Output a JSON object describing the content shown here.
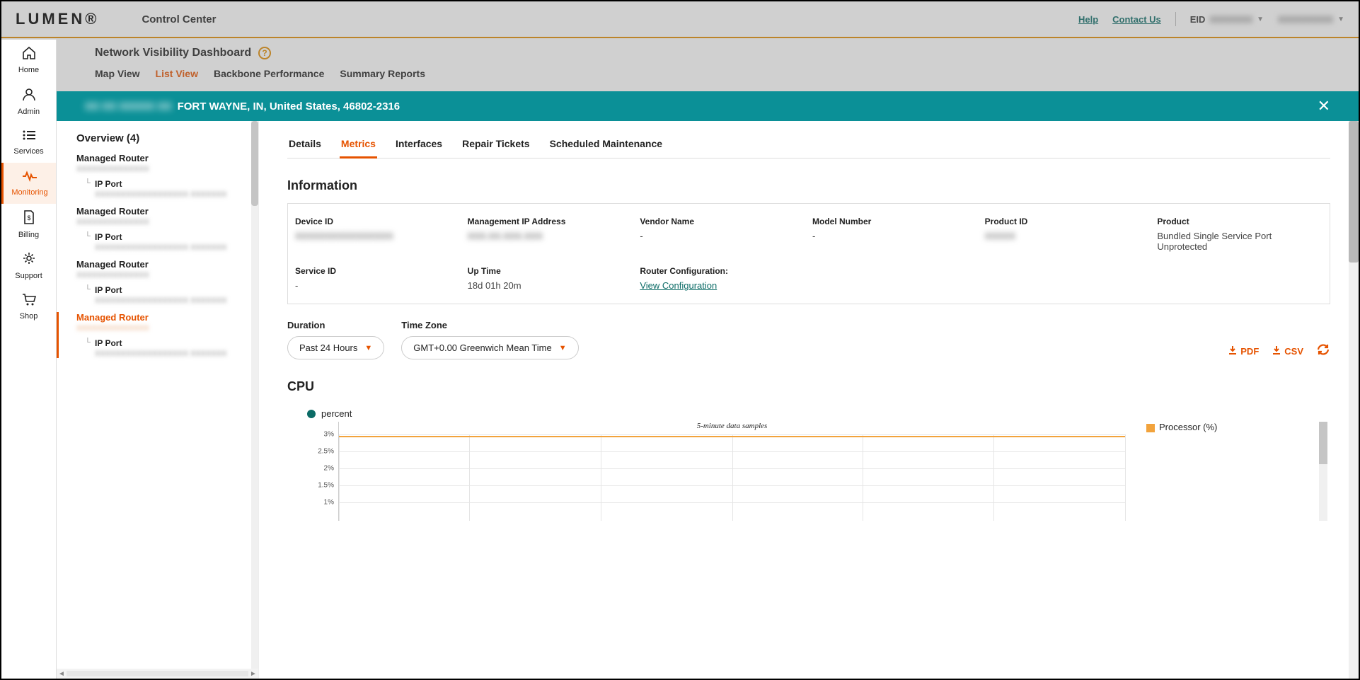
{
  "header": {
    "logo_text": "LUMEN",
    "app_name": "Control Center",
    "help": "Help",
    "contact": "Contact Us",
    "eid_label": "EID",
    "eid_value": "XXXXXXX",
    "user_value": "XXXXXXXXX"
  },
  "rail": {
    "items": [
      {
        "label": "Home",
        "icon": "home"
      },
      {
        "label": "Admin",
        "icon": "admin"
      },
      {
        "label": "Services",
        "icon": "services"
      },
      {
        "label": "Monitoring",
        "icon": "monitoring"
      },
      {
        "label": "Billing",
        "icon": "billing"
      },
      {
        "label": "Support",
        "icon": "support"
      },
      {
        "label": "Shop",
        "icon": "shop"
      }
    ]
  },
  "dashboard": {
    "title": "Network Visibility Dashboard",
    "tabs": [
      "Map View",
      "List View",
      "Backbone Performance",
      "Summary Reports"
    ],
    "active_tab": "List View"
  },
  "banner": {
    "id_blur": "XX XX XXXXX XX",
    "location": "FORT WAYNE, IN, United States, 46802-2316"
  },
  "tree": {
    "title": "Overview (4)",
    "nodes": [
      {
        "label": "Managed Router",
        "sub": "XXXXXXXXXXXXXX",
        "child_label": "IP Port",
        "child_sub": "XXXXXXXXXXXXXXXXXX   XXXXXXX",
        "selected": false
      },
      {
        "label": "Managed Router",
        "sub": "XXXXXXXXXXXXXX",
        "child_label": "IP Port",
        "child_sub": "XXXXXXXXXXXXXXXXXX   XXXXXXX",
        "selected": false
      },
      {
        "label": "Managed Router",
        "sub": "XXXXXXXXXXXXXX",
        "child_label": "IP Port",
        "child_sub": "XXXXXXXXXXXXXXXXXX   XXXXXXX",
        "selected": false
      },
      {
        "label": "Managed Router",
        "sub": "XXXXXXXXXXXXXX",
        "child_label": "IP Port",
        "child_sub": "XXXXXXXXXXXXXXXXXX   XXXXXXX",
        "selected": true
      }
    ]
  },
  "detail_tabs": [
    "Details",
    "Metrics",
    "Interfaces",
    "Repair Tickets",
    "Scheduled Maintenance"
  ],
  "detail_active": "Metrics",
  "info": {
    "title": "Information",
    "row1": {
      "device_id": {
        "label": "Device ID",
        "value": "XXXXXXXXXXXXXXXX",
        "blur": true
      },
      "mgmt_ip": {
        "label": "Management IP Address",
        "value": "XXX.XX.XXX.XXX",
        "blur": true
      },
      "vendor": {
        "label": "Vendor Name",
        "value": "-"
      },
      "model": {
        "label": "Model Number",
        "value": "-"
      },
      "product_id": {
        "label": "Product ID",
        "value": "XXXXX",
        "blur": true
      },
      "product": {
        "label": "Product",
        "value": "Bundled Single Service Port Unprotected"
      }
    },
    "row2": {
      "service_id": {
        "label": "Service ID",
        "value": "-"
      },
      "uptime": {
        "label": "Up Time",
        "value": "18d 01h 20m"
      },
      "router_cfg": {
        "label": "Router Configuration:",
        "link": "View Configuration"
      }
    }
  },
  "filters": {
    "duration_label": "Duration",
    "duration_value": "Past 24 Hours",
    "tz_label": "Time Zone",
    "tz_value": "GMT+0.00 Greenwich Mean Time",
    "pdf": "PDF",
    "csv": "CSV"
  },
  "chart": {
    "title": "CPU",
    "unit": "percent",
    "subtitle": "5-minute data samples",
    "legend": "Processor (%)"
  },
  "chart_data": {
    "type": "line",
    "title": "5-minute data samples",
    "ylabel": "percent",
    "ylim": [
      0.5,
      3
    ],
    "yticks": [
      "3%",
      "2.5%",
      "2%",
      "1.5%",
      "1%"
    ],
    "series": [
      {
        "name": "Processor (%)",
        "value_constant": 3
      }
    ],
    "note": "Single flat line at ~3% across all 5-minute samples in the past 24 hours"
  }
}
